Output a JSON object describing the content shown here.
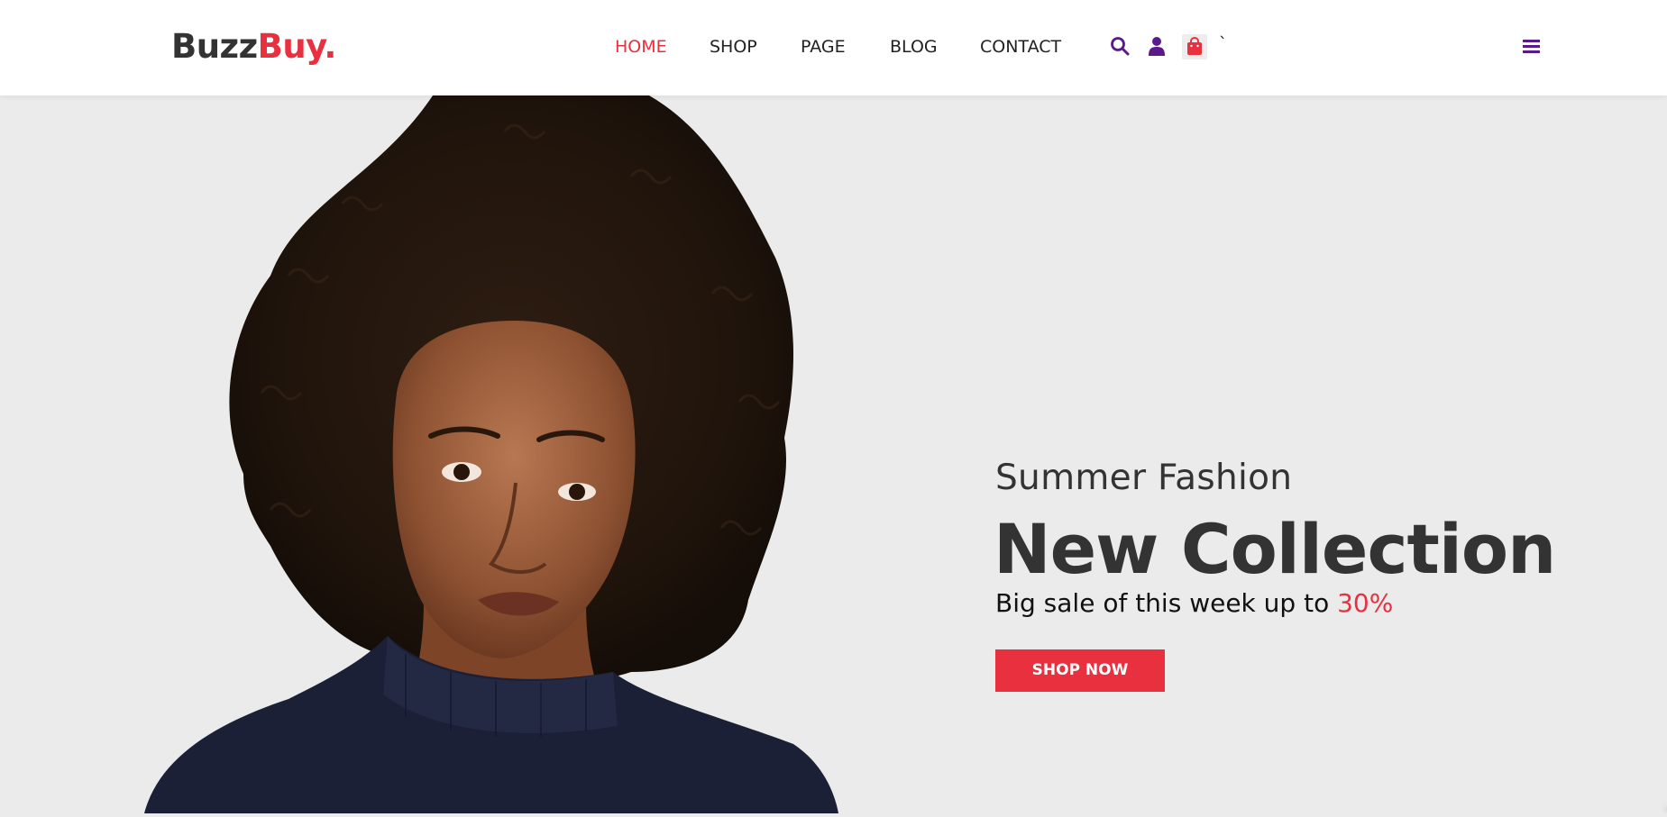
{
  "brand": {
    "name_dark": "Buzz",
    "name_accent": "Buy."
  },
  "nav": {
    "items": [
      {
        "label": "HOME",
        "active": true
      },
      {
        "label": "SHOP",
        "active": false
      },
      {
        "label": "PAGE",
        "active": false
      },
      {
        "label": "BLOG",
        "active": false
      },
      {
        "label": "CONTACT",
        "active": false
      }
    ]
  },
  "header_icons": [
    "search-icon",
    "user-icon",
    "shopping-bag-icon",
    "menu-icon"
  ],
  "stray_mark": "`",
  "hero": {
    "subtitle": "Summer Fashion",
    "title": "New Collection",
    "desc_prefix": "Big sale of this week up to ",
    "desc_highlight": "30%",
    "button_label": "SHOP NOW"
  },
  "colors": {
    "accent": "#e8303f",
    "icon_purple": "#5a1a8c",
    "text_dark": "#333333",
    "hero_bg": "#ebebeb",
    "header_bg": "#ffffff"
  }
}
